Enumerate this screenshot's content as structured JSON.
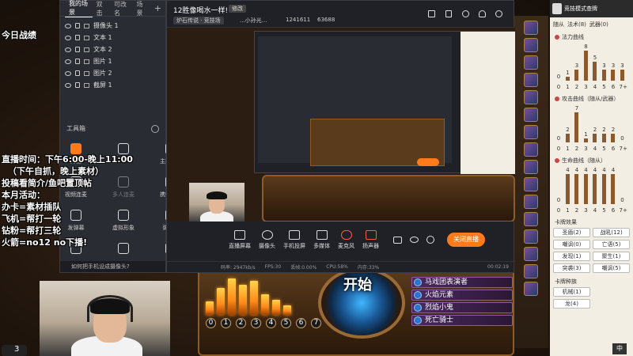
{
  "obs": {
    "tabs": [
      "我的场景",
      "双击",
      "可改名",
      "场景"
    ],
    "add_icon": "+",
    "sources": [
      "摄像头 1",
      "文本 1",
      "文本 2",
      "图片 1",
      "图片 2",
      "截屏 1"
    ],
    "tools_label": "工具箱",
    "tools": [
      {
        "label": "开播",
        "icon": "live-icon",
        "dim": false
      },
      {
        "label": "",
        "icon": "user-icon",
        "dim": false
      },
      {
        "label": "主播任务",
        "icon": "task-icon",
        "dim": false
      },
      {
        "label": "视频连麦",
        "icon": "video-link-icon",
        "dim": false
      },
      {
        "label": "多人连麦",
        "icon": "multi-link-icon",
        "dim": true
      },
      {
        "label": "携带助手",
        "icon": "assistant-icon",
        "dim": false
      },
      {
        "label": "发弹幕",
        "icon": "danmu-icon",
        "dim": false
      },
      {
        "label": "虚拟形象",
        "icon": "avatar-icon",
        "dim": false
      },
      {
        "label": "弹幕卷",
        "icon": "scroll-icon",
        "dim": false
      },
      {
        "label": "",
        "icon": "tool-icon",
        "dim": false
      },
      {
        "label": "",
        "icon": "hot-icon",
        "dim": false
      },
      {
        "label": "",
        "icon": "download-icon",
        "dim": false
      }
    ],
    "prompt": "如何把手机设成摄像头?"
  },
  "stream": {
    "title": "12胜像喝水一样!",
    "edit": "修改",
    "category": "炉石传说 · 竞技场",
    "streamer": "...小孙光...",
    "room_id": "1241611",
    "fans": "63688",
    "controls": [
      "直播屏幕",
      "摄像头",
      "手机投屏",
      "多媒体",
      "麦克风",
      "扬声器"
    ],
    "stop_button": "关闭直播",
    "status": [
      "码率: 2947kb/s",
      "FPS:30",
      "丢帧:0.00%",
      "CPU:58%",
      "内存:33%"
    ],
    "timer": "00:02:19"
  },
  "overlay": {
    "today": "今日战绩",
    "lines": [
      "直播时间：下午6:00-晚上11:00",
      "（下午自抓，晚上素材）",
      "投稿看简介/鱼吧置顶帖",
      "本月活动：",
      "办卡=素材插队",
      "飞机=帮打一轮",
      "钻粉=帮打三轮",
      "火箭=no12 no下播!"
    ]
  },
  "game": {
    "play_label": "开始",
    "costs": [
      "0",
      "1",
      "2",
      "3",
      "4",
      "5",
      "6",
      "7"
    ],
    "bar_heights": [
      0.35,
      0.7,
      0.95,
      0.8,
      0.9,
      0.55,
      0.4,
      0.25
    ],
    "cards": [
      "马戏团表演者",
      "火焰元素",
      "烈焰小鬼",
      "死亡骑士"
    ],
    "counter": "3",
    "icon_left": "hero-icon"
  },
  "tracker": {
    "title": "竞技模式查牌",
    "filters": [
      "随从",
      "法术(8)",
      "武器(0)"
    ],
    "charts": [
      {
        "title": "法力曲线",
        "values": [
          0,
          1,
          3,
          8,
          5,
          3,
          3,
          3
        ]
      },
      {
        "title": "攻击曲线（随从/武器）",
        "values": [
          0,
          2,
          7,
          1,
          2,
          2,
          2,
          0
        ]
      },
      {
        "title": "生命曲线（随从）",
        "values": [
          0,
          4,
          4,
          4,
          4,
          4,
          4,
          0
        ]
      }
    ],
    "chart_categories": [
      "0",
      "1",
      "2",
      "3",
      "4",
      "5",
      "6",
      "7+"
    ],
    "effects_title": "卡牌效果",
    "effects": [
      "圣盾(2)",
      "战吼(12)",
      "嘲讽(0)",
      "亡语(5)",
      "发现(1)",
      "聚生(1)",
      "突袭(3)",
      "嘲讽(5)"
    ],
    "race_title": "卡牌种族",
    "races": [
      "机械(1)",
      "",
      "龙(4)",
      ""
    ],
    "ime": "中"
  },
  "colors": {
    "accent": "#ff7a1a",
    "obs_bg": "#2a2c33",
    "tracker_bg": "#f3eee3"
  }
}
